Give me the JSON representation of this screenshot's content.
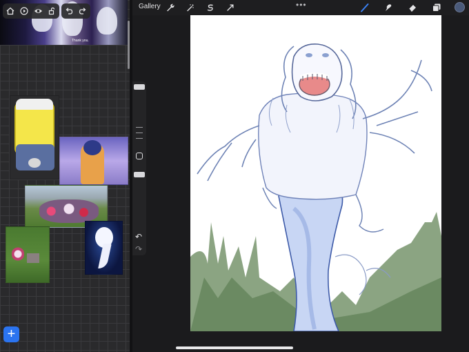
{
  "topbar": {
    "gallery_label": "Gallery",
    "more_label": "•••",
    "tools": [
      "wrench-icon",
      "adjustments-wand-icon",
      "selection-s-icon",
      "transform-arrow-icon"
    ],
    "right_tools": [
      "brush-icon",
      "smudge-icon",
      "eraser-icon",
      "layers-icon"
    ],
    "active_color": "#4a5a7a",
    "active_tool_color": "#3b82f6"
  },
  "reference_panel": {
    "video_caption": "Thank you.",
    "mini_toolbar": [
      "home-icon",
      "play-icon",
      "eye-icon",
      "lock-icon",
      "undo-icon",
      "redo-icon"
    ],
    "add_label": "+"
  },
  "side_panel": {
    "undo_label": "↶",
    "redo_label": "↷"
  }
}
